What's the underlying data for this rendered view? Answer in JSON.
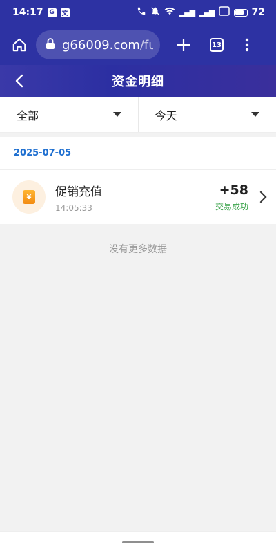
{
  "status_bar": {
    "time": "14:17",
    "badge_a": "G",
    "badge_b": "文",
    "battery_level": "72"
  },
  "browser": {
    "url_domain": "g66009.com",
    "url_rest": "/fun",
    "tab_count": "13"
  },
  "header": {
    "title": "资金明细"
  },
  "filters": {
    "type": "全部",
    "date": "今天"
  },
  "date_group": "2025-07-05",
  "transaction": {
    "title": "促销充值",
    "time": "14:05:33",
    "amount": "+58",
    "status": "交易成功",
    "icon_glyph": "¥",
    "status_color": "#3aa34a"
  },
  "no_more_text": "没有更多数据",
  "colors": {
    "header": "#2d32a3",
    "date_text": "#1e6fd0",
    "icon_bg": "#fdf0e0"
  }
}
